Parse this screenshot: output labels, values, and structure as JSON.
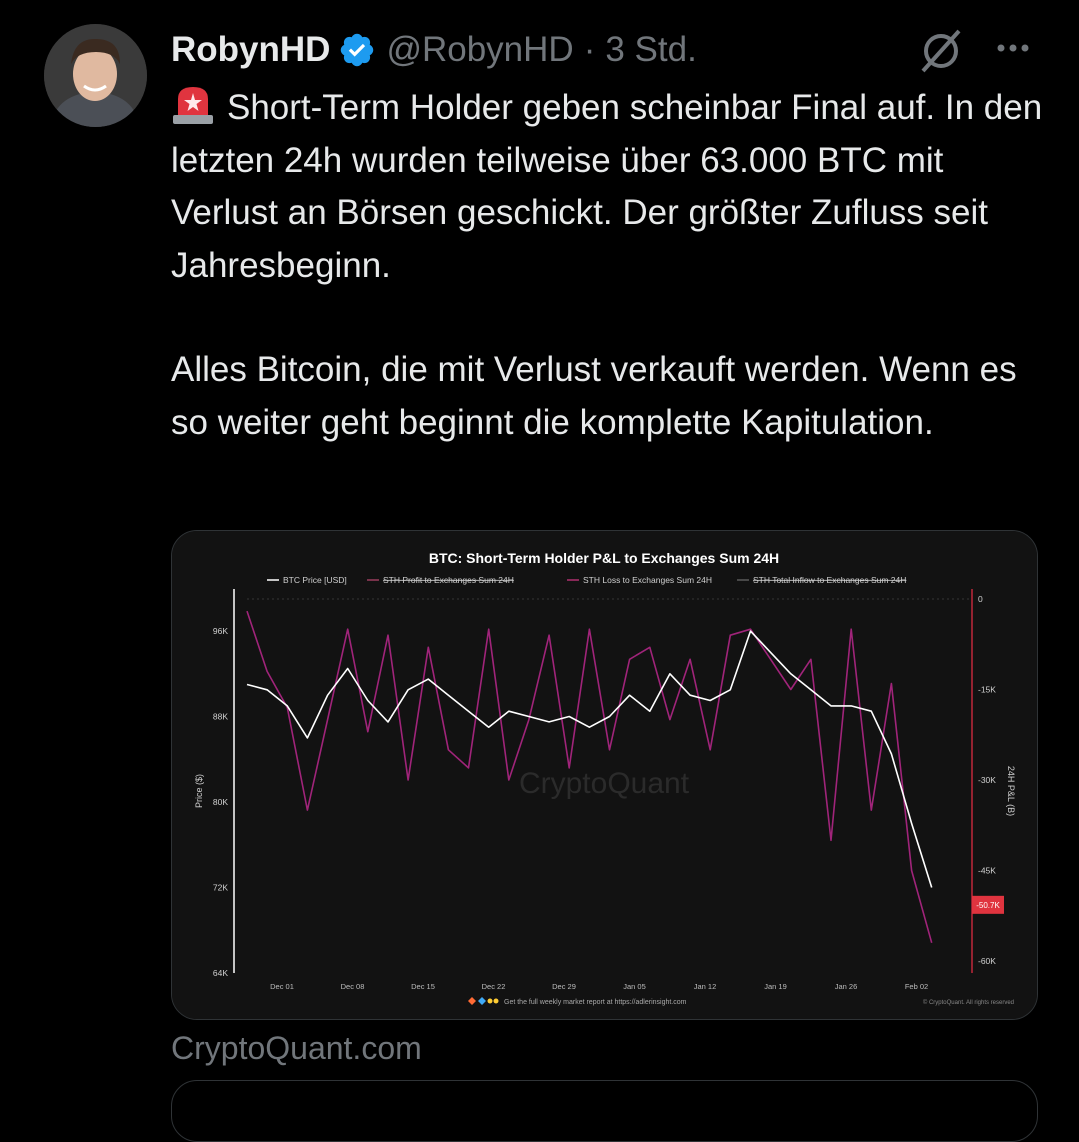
{
  "tweet": {
    "display_name": "RobynHD",
    "handle": "@RobynHD",
    "separator": "·",
    "time": "3 Std.",
    "paragraph1": "Short-Term Holder geben scheinbar Final auf. In den letzten 24h wurden teilweise über 63.000 BTC mit Verlust an Börsen geschickt. Der größter Zufluss seit Jahresbeginn.",
    "paragraph2": "Alles Bitcoin, die mit Verlust verkauft werden. Wenn es so weiter geht beginnt die komplette Kapitulation.",
    "link_domain": "CryptoQuant.com"
  },
  "icons": {
    "verified": "verified-badge-icon",
    "grok": "grok-icon",
    "more": "more-icon",
    "siren": "siren-emoji-icon"
  },
  "colors": {
    "background": "#000000",
    "text": "#e7e9ea",
    "muted": "#71767b",
    "verified": "#1d9bf0",
    "price_line": "#ffffff",
    "loss_line": "#a0247a",
    "badge": "#e0343f"
  },
  "chart_data": {
    "type": "line",
    "title": "BTC: Short-Term Holder P&L to Exchanges Sum 24H",
    "legend": [
      "BTC Price [USD]",
      "STH Profit to Exchanges Sum 24H",
      "STH Loss to Exchanges Sum 24H",
      "STH Total Inflow to Exchanges Sum 24H"
    ],
    "legend_placement": "top",
    "ylabel_left": "Price ($)",
    "ylabel_right": "24H P&L (B)",
    "y_left_ticks": [
      "96K",
      "88K",
      "80K",
      "72K",
      "64K"
    ],
    "y_left_range": [
      64000,
      99000
    ],
    "y_right_ticks": [
      "0",
      "-15K",
      "-30K",
      "-45K",
      "-60K"
    ],
    "y_right_range": [
      -62000,
      0
    ],
    "x_ticks": [
      "Dec 01",
      "Dec 08",
      "Dec 15",
      "Dec 22",
      "Dec 29",
      "Jan 05",
      "Jan 12",
      "Jan 19",
      "Jan 26",
      "Feb 02"
    ],
    "current_value_label": "-50.7K",
    "watermark": "CryptoQuant",
    "footer": "Get the full weekly market report at https://adlerinsight.com",
    "copyright": "© CryptoQuant. All rights reserved",
    "series": [
      {
        "name": "BTC Price [USD]",
        "axis": "left",
        "x": [
          0,
          2,
          4,
          6,
          8,
          10,
          12,
          14,
          16,
          18,
          20,
          22,
          24,
          26,
          28,
          30,
          32,
          34,
          36,
          38,
          40,
          42,
          44,
          46,
          48,
          50,
          52,
          54,
          56,
          58,
          60,
          62,
          64,
          66,
          68
        ],
        "y": [
          91000,
          90500,
          89000,
          86000,
          90000,
          92500,
          89500,
          87500,
          90500,
          91500,
          90000,
          88500,
          87000,
          88500,
          88000,
          87500,
          88000,
          87000,
          88000,
          90000,
          88500,
          92000,
          90000,
          89500,
          90500,
          96000,
          94000,
          92000,
          90500,
          89000,
          89000,
          88500,
          84500,
          78000,
          72000
        ]
      },
      {
        "name": "STH Loss to Exchanges Sum 24H",
        "axis": "right",
        "x": [
          0,
          2,
          4,
          6,
          8,
          10,
          12,
          14,
          16,
          18,
          20,
          22,
          24,
          26,
          28,
          30,
          32,
          34,
          36,
          38,
          40,
          42,
          44,
          46,
          48,
          50,
          52,
          54,
          56,
          58,
          60,
          62,
          64,
          66,
          68
        ],
        "y": [
          -2000,
          -12000,
          -18000,
          -35000,
          -20000,
          -5000,
          -22000,
          -6000,
          -30000,
          -8000,
          -25000,
          -28000,
          -5000,
          -30000,
          -20000,
          -6000,
          -28000,
          -5000,
          -25000,
          -10000,
          -8000,
          -20000,
          -10000,
          -25000,
          -6000,
          -5000,
          -10000,
          -15000,
          -10000,
          -40000,
          -5000,
          -35000,
          -14000,
          -45000,
          -57000
        ]
      }
    ]
  }
}
